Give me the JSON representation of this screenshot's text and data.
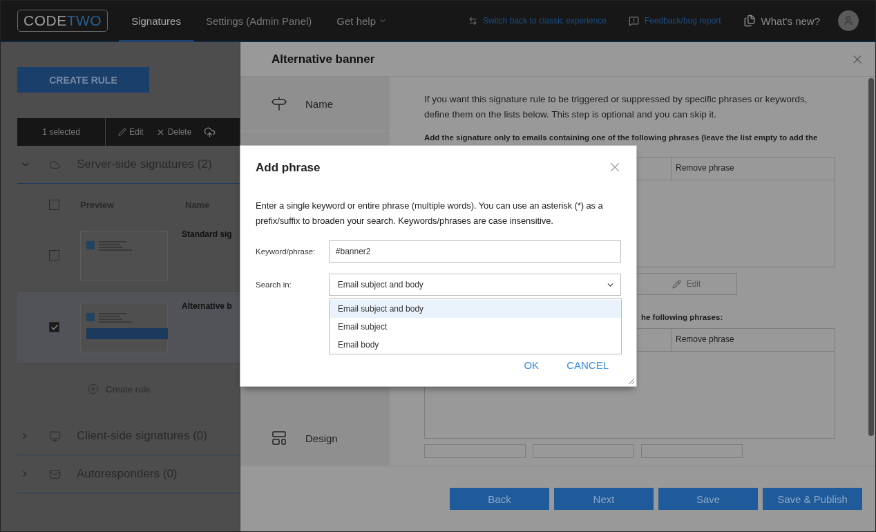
{
  "header": {
    "logo_parts": [
      "CODE",
      "TWO"
    ],
    "nav": [
      {
        "label": "Signatures",
        "selected": true
      },
      {
        "label": "Settings (Admin Panel)",
        "selected": false
      },
      {
        "label": "Get help",
        "selected": false
      }
    ],
    "links": [
      "Switch back to classic experience",
      "Feedback/bug report"
    ],
    "whats_new": "What's new?"
  },
  "rules_page": {
    "create_button": "CREATE RULE",
    "toolbar": {
      "selection": "1 selected",
      "actions": [
        "Edit",
        "Delete"
      ]
    },
    "groups": [
      {
        "title": "Server-side signatures (2)",
        "kind": "server",
        "expanded": true,
        "columns": [
          "Preview",
          "Name"
        ],
        "all_checked": false,
        "add_label": "Create rule",
        "rows": [
          {
            "name": "Standard sig",
            "checked": false,
            "banner": false
          },
          {
            "name": "Alternative b",
            "checked": true,
            "banner": true
          }
        ]
      },
      {
        "title": "Client-side signatures (0)",
        "kind": "client",
        "expanded": false
      },
      {
        "title": "Autoresponders (0)",
        "kind": "auto",
        "expanded": false
      }
    ]
  },
  "rule_panel": {
    "title": "Alternative banner",
    "steps": [
      {
        "label": "Name",
        "kind": "name"
      },
      {
        "label": "Design",
        "kind": "design"
      }
    ],
    "intro": "If you want this signature rule to be triggered or suppressed by specific phrases or keywords, define them on the lists below. This step is optional and you can skip it.",
    "include_heading": "Add the signature only to emails containing one of the following phrases (leave the list empty to add the",
    "include_table": {
      "column_2": "Remove phrase"
    },
    "edit_button": "Edit",
    "exclude_heading": "he following phrases:",
    "exclude_table": {
      "column_2": "Remove phrase"
    },
    "footer_buttons": [
      "Back",
      "Next",
      "Save",
      "Save & Publish"
    ]
  },
  "dialog": {
    "title": "Add phrase",
    "description": "Enter a single keyword or entire phrase (multiple words). You can use an asterisk (*) as a prefix/suffix to broaden your search. Keywords/phrases are case insensitive.",
    "keyword_label": "Keyword/phrase:",
    "keyword_value": "#banner2",
    "search_label": "Search in:",
    "search_value": "Email subject and body",
    "options": [
      {
        "label": "Email subject and body",
        "selected": true
      },
      {
        "label": "Email subject",
        "selected": false
      },
      {
        "label": "Email body",
        "selected": false
      }
    ],
    "buttons": [
      "OK",
      "CANCEL"
    ]
  }
}
